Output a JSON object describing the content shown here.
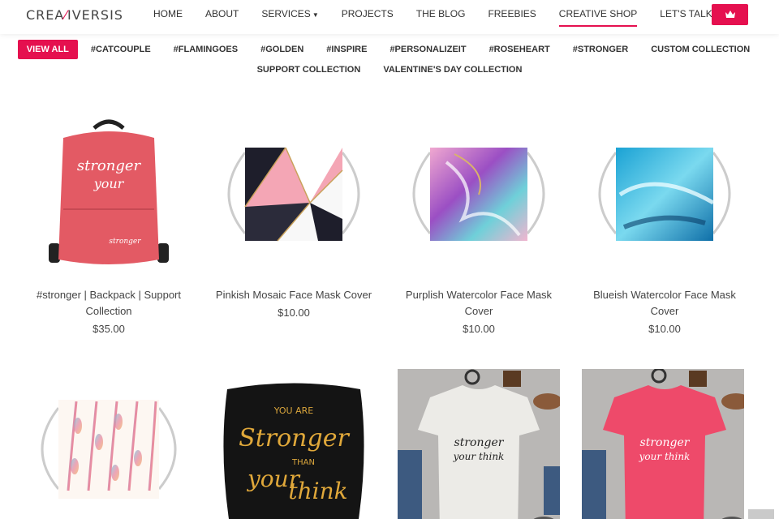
{
  "logo": {
    "text_left": "CREA",
    "text_right": "IVERSIS"
  },
  "nav": {
    "items": [
      {
        "label": "HOME"
      },
      {
        "label": "ABOUT"
      },
      {
        "label": "SERVICES",
        "dropdown": true
      },
      {
        "label": "PROJECTS"
      },
      {
        "label": "THE BLOG"
      },
      {
        "label": "FREEBIES"
      },
      {
        "label": "CREATIVE SHOP",
        "active": true
      },
      {
        "label": "LET'S TALK",
        "dropdown": true
      }
    ],
    "cart_icon": "crown-icon"
  },
  "filters": {
    "row1": [
      "VIEW ALL",
      "#CATCOUPLE",
      "#FLAMINGOES",
      "#GOLDEN",
      "#INSPIRE",
      "#PERSONALIZEIT",
      "#ROSEHEART",
      "#STRONGER",
      "CUSTOM COLLECTION"
    ],
    "row2": [
      "SUPPORT COLLECTION",
      "VALENTINE'S DAY COLLECTION"
    ],
    "active": "VIEW ALL"
  },
  "products": [
    {
      "title": "#stronger | Backpack | Support Collection",
      "price": "$35.00"
    },
    {
      "title": "Pinkish Mosaic Face Mask Cover",
      "price": "$10.00"
    },
    {
      "title": "Purplish Watercolor Face Mask Cover",
      "price": "$10.00"
    },
    {
      "title": "Blueish Watercolor Face Mask Cover",
      "price": "$10.00"
    },
    {
      "title": "",
      "price": ""
    },
    {
      "title": "",
      "price": ""
    },
    {
      "title": "",
      "price": ""
    },
    {
      "title": "",
      "price": ""
    }
  ],
  "art_text": {
    "pillow_line1": "YOU ARE",
    "pillow_line2": "Stronger",
    "pillow_line3": "THAN",
    "pillow_line4": "your",
    "pillow_line5": "think"
  },
  "colors": {
    "accent": "#e5104f"
  }
}
